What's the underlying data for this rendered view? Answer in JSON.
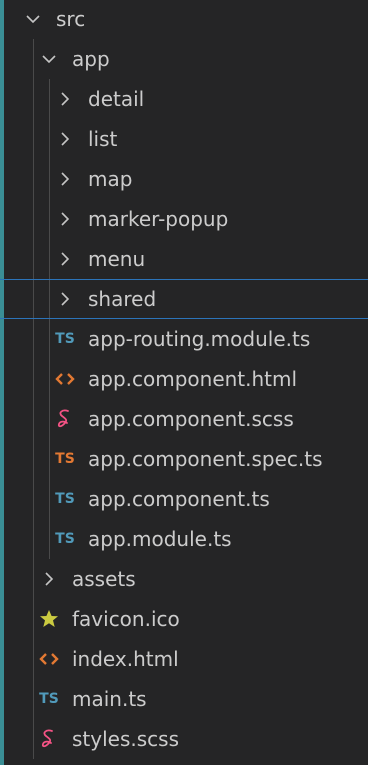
{
  "explorer": {
    "items": [
      {
        "label": "src",
        "icon": "chevron-down-icon",
        "depth": 0
      },
      {
        "label": "app",
        "icon": "chevron-down-icon",
        "depth": 1
      },
      {
        "label": "detail",
        "icon": "chevron-right-icon",
        "depth": 2
      },
      {
        "label": "list",
        "icon": "chevron-right-icon",
        "depth": 2
      },
      {
        "label": "map",
        "icon": "chevron-right-icon",
        "depth": 2
      },
      {
        "label": "marker-popup",
        "icon": "chevron-right-icon",
        "depth": 2
      },
      {
        "label": "menu",
        "icon": "chevron-right-icon",
        "depth": 2
      },
      {
        "label": "shared",
        "icon": "chevron-right-icon",
        "depth": 2
      },
      {
        "label": "app-routing.module.ts",
        "icon": "typescript-icon",
        "depth": 2
      },
      {
        "label": "app.component.html",
        "icon": "html-icon",
        "depth": 2
      },
      {
        "label": "app.component.scss",
        "icon": "sass-icon",
        "depth": 2
      },
      {
        "label": "app.component.spec.ts",
        "icon": "typescript-spec-icon",
        "depth": 2
      },
      {
        "label": "app.component.ts",
        "icon": "typescript-icon",
        "depth": 2
      },
      {
        "label": "app.module.ts",
        "icon": "typescript-icon",
        "depth": 2
      },
      {
        "label": "assets",
        "icon": "chevron-right-icon",
        "depth": 1
      },
      {
        "label": "favicon.ico",
        "icon": "star-icon",
        "depth": 1
      },
      {
        "label": "index.html",
        "icon": "html-icon",
        "depth": 1
      },
      {
        "label": "main.ts",
        "icon": "typescript-icon",
        "depth": 1
      },
      {
        "label": "styles.scss",
        "icon": "sass-icon",
        "depth": 1
      }
    ],
    "selected_label": "shared"
  },
  "icon_text": {
    "typescript": "TS"
  },
  "colors": {
    "background": "#252526",
    "text": "#cccccc",
    "chevron": "#c5c5c5",
    "typescript": "#519aba",
    "typescript_spec": "#e37933",
    "html": "#e37933",
    "sass": "#f55385",
    "star": "#cbcb41",
    "selection_border": "#2c74b9",
    "left_edge": "#3a8e95"
  }
}
